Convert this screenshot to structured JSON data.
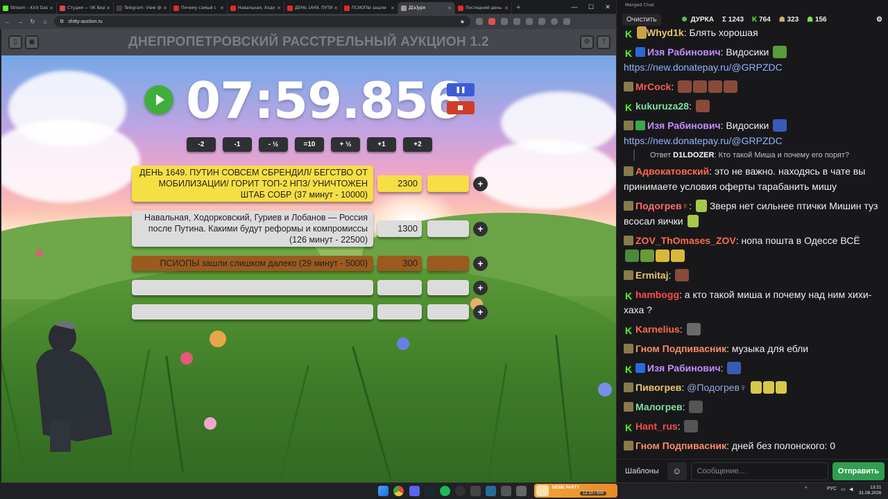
{
  "browser": {
    "tabs": [
      {
        "title": "Stream – Kick Das",
        "color": "#53fc18"
      },
      {
        "title": "Студия — VK Видео",
        "color": "#e14545"
      },
      {
        "title": "Telegram: View @",
        "color": "#444"
      },
      {
        "title": "Почему самый с",
        "color": "#e02b2b"
      },
      {
        "title": "Навальная, Ходо",
        "color": "#e02b2b"
      },
      {
        "title": "ДЕНЬ 1649. ПУТИ",
        "color": "#e02b2b"
      },
      {
        "title": "ПСИОПЫ зашли",
        "color": "#e02b2b"
      },
      {
        "title": "Д[а]уря",
        "color": "#999"
      },
      {
        "title": "Последний день",
        "color": "#e02b2b"
      }
    ],
    "url": "shitty-auction.ru"
  },
  "auction": {
    "title": "ДНЕПРОПЕТРОВСКИЙ РАССТРЕЛЬНЫЙ АУКЦИОН 1.2",
    "timer": "07:59.856",
    "adjust_buttons": [
      "-2",
      "-1",
      "- ½",
      "=10",
      "+ ½",
      "+1",
      "+2"
    ],
    "lots": [
      {
        "text": "ДЕНЬ 1649. ПУТИН СОВСЕМ СБРЕНДИЛ/ БЕГСТВО ОТ МОБИЛИЗАЦИИ/ ГОРИТ ТОП-2 НПЗ/ УНИЧТОЖЕН ШТАБ СОБР (37 минут - 10000)",
        "amount": "2300",
        "color": "yellow"
      },
      {
        "text": "Навальная, Ходорковский, Гуриев и Лобанов — Россия после Путина. Какими будут реформы и компромиссы (126 минут - 22500)",
        "amount": "1300",
        "color": "gray"
      },
      {
        "text": "ПСИОПЫ зашли слишком далеко (29 минут - 5000)",
        "amount": "300",
        "color": "brown"
      },
      {
        "text": "",
        "amount": "",
        "color": "gray"
      },
      {
        "text": "",
        "amount": "",
        "color": "gray"
      }
    ],
    "plus_label": "+"
  },
  "chat": {
    "window_title": "Merged Chat",
    "clear_label": "Очистить",
    "streamer": "ДУРКА",
    "total": "Σ 1243",
    "kick_count": "764",
    "other_count": "323",
    "vk_count": "156",
    "messages": [
      {
        "platform": "kick",
        "name": "Whyd1k",
        "name_color": "#e8c66a",
        "text": "Блять хорошая"
      },
      {
        "platform": "kick",
        "name": "Изя Рабинович",
        "name_color": "#c28cff",
        "text": "Видосики",
        "link": "https://new.donatepay.ru/@GRPZDC"
      },
      {
        "platform": "vk",
        "name": "MrCock",
        "name_color": "#ff5a4a",
        "text": ""
      },
      {
        "platform": "kick",
        "name": "kukuruza28",
        "name_color": "#7ee0a0",
        "text": ""
      },
      {
        "platform": "vk",
        "name": "Изя Рабинович",
        "name_color": "#c28cff",
        "text": "Видосики",
        "link": "https://new.donatepay.ru/@GRPZDC"
      },
      {
        "reply_prefix": "Ответ",
        "reply_name": "D1LDOZER",
        "reply_text": "Кто такой Миша и почему его порят?"
      },
      {
        "platform": "vk",
        "name": "Адвокатовский",
        "name_color": "#ff6a4a",
        "text": "это не важно. находясь в чате вы принимаете условия оферты тарабанить мишу"
      },
      {
        "platform": "vk",
        "name": "Подогрев♀",
        "name_color": "#ff6a6a",
        "text": "Зверя нет сильнее птички  Мишин туз всосал яички"
      },
      {
        "platform": "vk",
        "name": "ZOV_ThOmases_ZOV",
        "name_color": "#ff6a4a",
        "text": "нопа пошта в Одессе ВСЁ"
      },
      {
        "platform": "kick",
        "name": "Ermitaj",
        "name_color": "#e8c66a",
        "text": ""
      },
      {
        "platform": "kick",
        "name": "hambogg",
        "name_color": "#ff4a4a",
        "text": "а кто такой миша и почему над ним хихи-хаха ?"
      },
      {
        "platform": "kick",
        "name": "Karnelius",
        "name_color": "#ff6a4a",
        "text": ""
      },
      {
        "platform": "vk",
        "name": "Гном Подпивасник",
        "name_color": "#ff8a6a",
        "text": "музыка для ебли"
      },
      {
        "platform": "kick",
        "name": "Изя Рабинович",
        "name_color": "#c28cff",
        "text": ""
      },
      {
        "platform": "vk",
        "name": "Пивогрев",
        "name_color": "#e8c66a",
        "text": "@Подогрев♀"
      },
      {
        "platform": "vk",
        "name": "Малогрев",
        "name_color": "#7ee0a0",
        "text": ""
      },
      {
        "platform": "kick",
        "name": "Hant_rus",
        "name_color": "#ff4a4a",
        "text": ""
      },
      {
        "platform": "vk",
        "name": "Гном Подпивасник",
        "name_color": "#ff8a6a",
        "text": "дней без полонского: 0"
      }
    ],
    "templates_label": "Шаблоны",
    "input_placeholder": "Сообщение...",
    "send_label": "Отправить"
  },
  "taskbar": {
    "widget_label": "MEME PARTY",
    "widget_value": "12:10 / 500",
    "lang": "РУС",
    "time": "13:21",
    "date": "31.08.2026"
  }
}
